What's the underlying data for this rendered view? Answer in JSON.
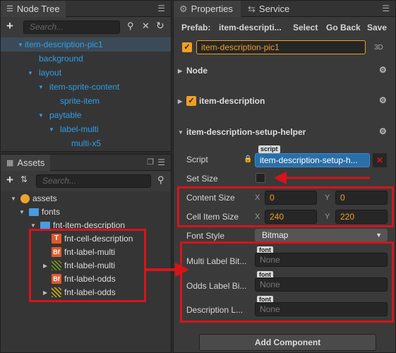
{
  "node_tree": {
    "title": "Node Tree",
    "search_placeholder": "Search...",
    "items": [
      {
        "label": "item-description-pic1",
        "depth": 0,
        "arrow": "▼"
      },
      {
        "label": "background",
        "depth": 1,
        "arrow": ""
      },
      {
        "label": "layout",
        "depth": 1,
        "arrow": "▼"
      },
      {
        "label": "item-sprite-content",
        "depth": 2,
        "arrow": "▼"
      },
      {
        "label": "sprite-item",
        "depth": 3,
        "arrow": ""
      },
      {
        "label": "paytable",
        "depth": 2,
        "arrow": "▼"
      },
      {
        "label": "label-multi",
        "depth": 3,
        "arrow": "▼"
      },
      {
        "label": "multi-x5",
        "depth": 4,
        "arrow": ""
      }
    ]
  },
  "assets": {
    "title": "Assets",
    "search_placeholder": "Search...",
    "items": [
      {
        "label": "assets",
        "icon": "db"
      },
      {
        "label": "fonts",
        "icon": "folder"
      },
      {
        "label": "fnt-item-description",
        "icon": "folder"
      },
      {
        "label": "fnt-cell-description",
        "icon": "T"
      },
      {
        "label": "fnt-label-multi",
        "icon": "Bf"
      },
      {
        "label": "fnt-label-multi",
        "icon": "atlas"
      },
      {
        "label": "fnt-label-odds",
        "icon": "Bf"
      },
      {
        "label": "fnt-label-odds",
        "icon": "atlas"
      }
    ]
  },
  "properties": {
    "tab_properties": "Properties",
    "tab_service": "Service",
    "prefab_label": "Prefab:",
    "prefab_name": "item-descripti...",
    "select_label": "Select",
    "goback_label": "Go Back",
    "save_label": "Save",
    "node_name": "item-description-pic1",
    "three_d": "3D",
    "section_node": "Node",
    "section_item_desc": "item-description",
    "section_helper": "item-description-setup-helper",
    "script_label": "Script",
    "script_tag": "script",
    "script_value": "item-description-setup-h...",
    "set_size_label": "Set Size",
    "content_size_label": "Content Size",
    "content_x_axis": "X",
    "content_x": "0",
    "content_y_axis": "Y",
    "content_y": "0",
    "cell_size_label": "Cell Item Size",
    "cell_x_axis": "X",
    "cell_x": "240",
    "cell_y_axis": "Y",
    "cell_y": "220",
    "font_style_label": "Font Style",
    "font_style_value": "Bitmap",
    "font_tag": "font",
    "multi_label": "Multi Label Bit...",
    "odds_label": "Odds Label Bi...",
    "desc_label": "Description L...",
    "none_value": "None",
    "add_component": "Add Component"
  },
  "colors": {
    "accent": "#2ea0ea",
    "highlight": "#d7141a",
    "value": "#f0a020"
  }
}
